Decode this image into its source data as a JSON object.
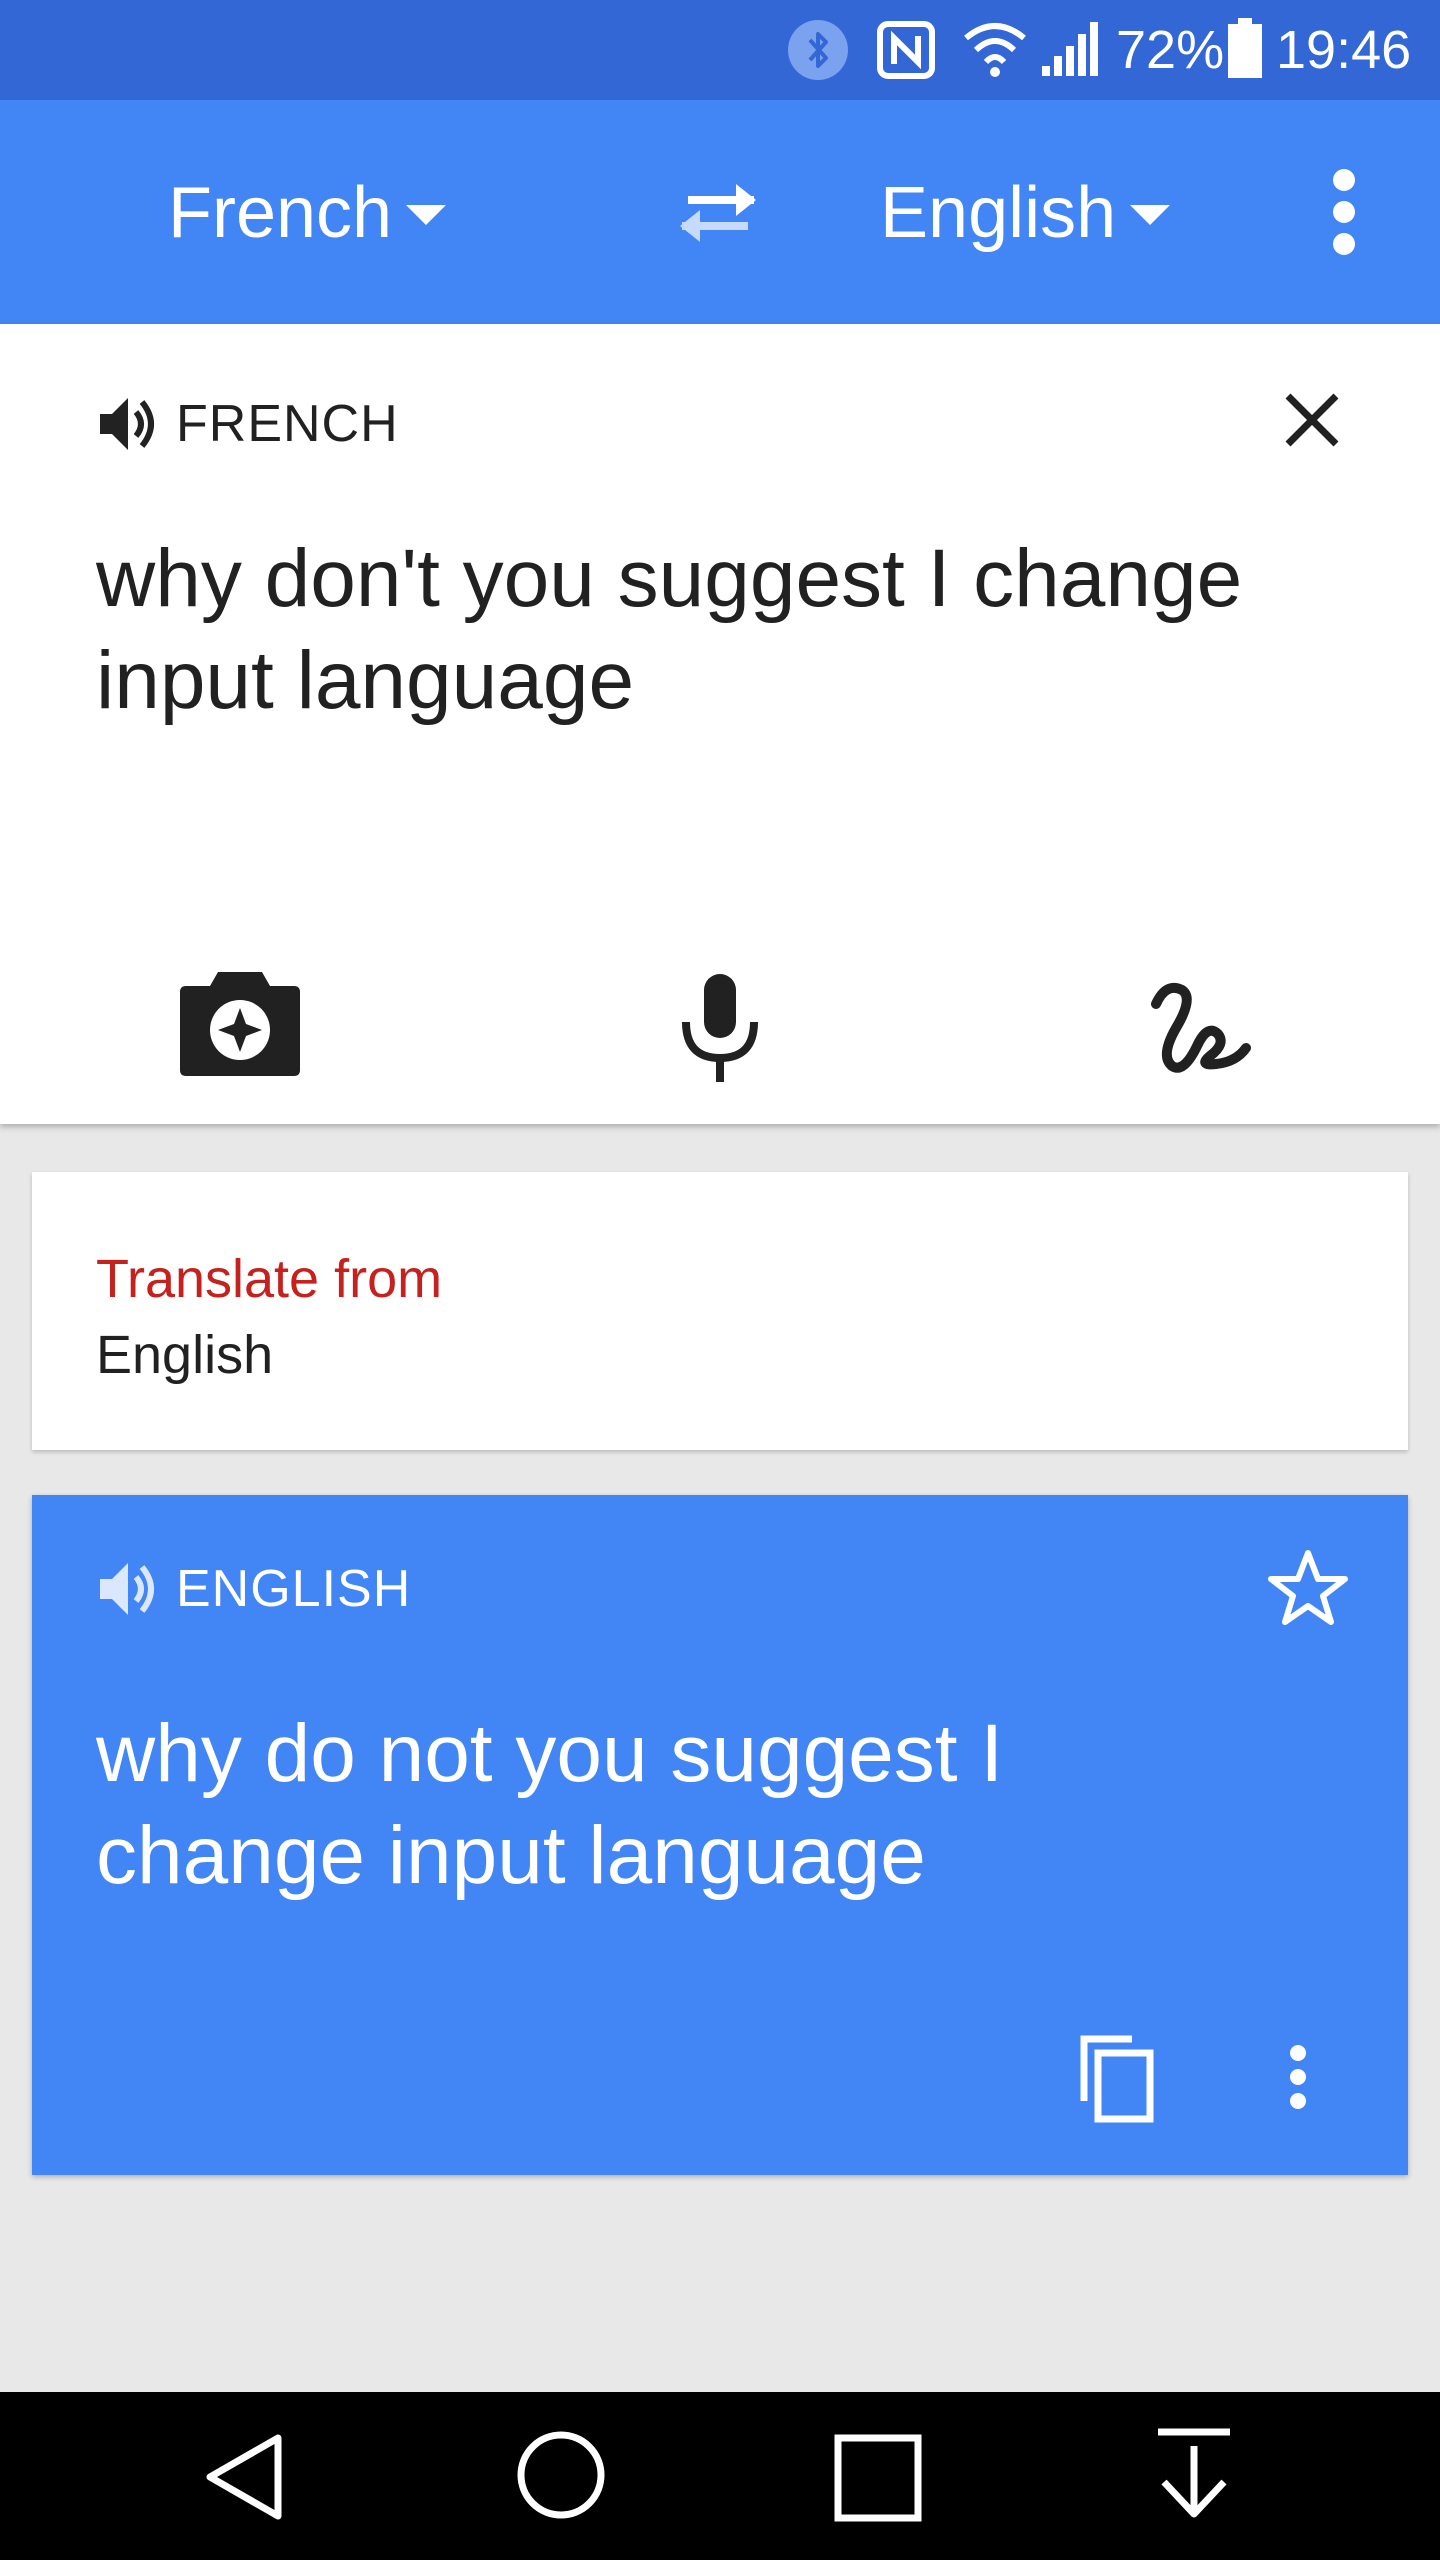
{
  "status_bar": {
    "battery": "72%",
    "time": "19:46",
    "icons": [
      "bluetooth-icon",
      "nfc-icon",
      "wifi-icon",
      "signal-icon",
      "battery-icon"
    ]
  },
  "app_bar": {
    "source_language": "French",
    "target_language": "English",
    "swap_icon": "swap-arrows-icon",
    "menu_icon": "more-vert-icon"
  },
  "input_card": {
    "language_label": "FRENCH",
    "input_text": "why don't you suggest I change input language",
    "tools": [
      "camera-icon",
      "microphone-icon",
      "handwriting-icon"
    ]
  },
  "suggestion_card": {
    "title": "Translate from",
    "language": "English"
  },
  "output_card": {
    "language_label": "ENGLISH",
    "translated_text": "why do not you suggest I change input language",
    "icons": [
      "star-icon",
      "copy-icon",
      "more-vert-icon"
    ]
  },
  "colors": {
    "status_bar": "#3367d6",
    "primary": "#4285f4",
    "suggestion_title": "#c5221f",
    "background": "#e8e8e8"
  },
  "nav_bar": {
    "icons": [
      "back-icon",
      "home-icon",
      "recents-icon",
      "notification-pull-icon"
    ]
  }
}
